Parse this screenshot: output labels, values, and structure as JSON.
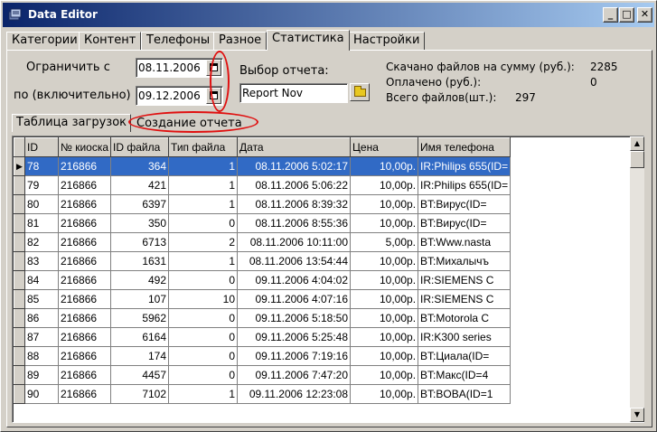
{
  "window": {
    "title": "Data Editor"
  },
  "title_buttons": {
    "minimize": "_",
    "maximize": "□",
    "close": "✕"
  },
  "tabs": [
    "Категории",
    "Контент",
    "Телефоны",
    "Разное",
    "Статистика",
    "Настройки"
  ],
  "active_tab": "Статистика",
  "filter": {
    "from_label": "Ограничить с",
    "from_date": "08.11.2006",
    "to_label": "по (включительно)",
    "to_date": "09.12.2006"
  },
  "report": {
    "label": "Выбор отчета:",
    "value": "Report Nov"
  },
  "stats": {
    "downloaded_label": "Скачано файлов на сумму (руб.):",
    "downloaded_value": "2285",
    "paid_label": "Оплачено (руб.):",
    "paid_value": "0",
    "total_label": "Всего файлов(шт.):",
    "total_value": "297"
  },
  "subtabs": [
    "Таблица загрузок",
    "Создание отчета"
  ],
  "annotation_color": "#e01010",
  "grid": {
    "columns": [
      "ID",
      "№ киоска",
      "ID файла",
      "Тип файла",
      "Дата",
      "Цена",
      "Имя телефона"
    ],
    "rows": [
      [
        "78",
        "216866",
        "364",
        "1",
        "08.11.2006 5:02:17",
        "10,00р.",
        "IR:Philips 655(ID="
      ],
      [
        "79",
        "216866",
        "421",
        "1",
        "08.11.2006 5:06:22",
        "10,00р.",
        "IR:Philips 655(ID="
      ],
      [
        "80",
        "216866",
        "6397",
        "1",
        "08.11.2006 8:39:32",
        "10,00р.",
        "BT:Вирус(ID="
      ],
      [
        "81",
        "216866",
        "350",
        "0",
        "08.11.2006 8:55:36",
        "10,00р.",
        "BT:Вирус(ID="
      ],
      [
        "82",
        "216866",
        "6713",
        "2",
        "08.11.2006 10:11:00",
        "5,00р.",
        "BT:Www.nasta"
      ],
      [
        "83",
        "216866",
        "1631",
        "1",
        "08.11.2006 13:54:44",
        "10,00р.",
        "BT:Михалычъ"
      ],
      [
        "84",
        "216866",
        "492",
        "0",
        "09.11.2006 4:04:02",
        "10,00р.",
        "IR:SIEMENS C"
      ],
      [
        "85",
        "216866",
        "107",
        "10",
        "09.11.2006 4:07:16",
        "10,00р.",
        "IR:SIEMENS C"
      ],
      [
        "86",
        "216866",
        "5962",
        "0",
        "09.11.2006 5:18:50",
        "10,00р.",
        "BT:Motorola C"
      ],
      [
        "87",
        "216866",
        "6164",
        "0",
        "09.11.2006 5:25:48",
        "10,00р.",
        "IR:K300 series"
      ],
      [
        "88",
        "216866",
        "174",
        "0",
        "09.11.2006 7:19:16",
        "10,00р.",
        "BT:Циала(ID="
      ],
      [
        "89",
        "216866",
        "4457",
        "0",
        "09.11.2006 7:47:20",
        "10,00р.",
        "BT:Макс(ID=4"
      ],
      [
        "90",
        "216866",
        "7102",
        "1",
        "09.11.2006 12:23:08",
        "10,00р.",
        "BT:BOBA(ID=1"
      ]
    ]
  },
  "current_row_marker": "▶",
  "scroll": {
    "up": "▲",
    "down": "▼"
  }
}
